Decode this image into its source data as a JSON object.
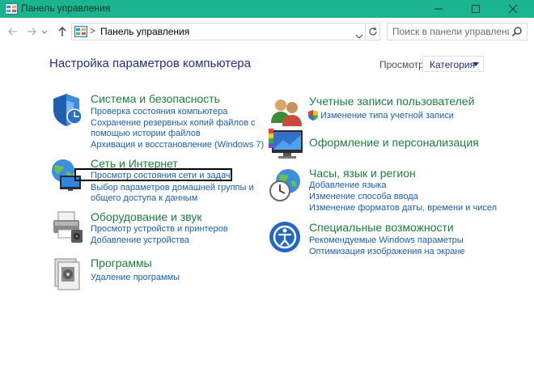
{
  "window": {
    "title": "Панель управления",
    "accent_color": "#1bb48f"
  },
  "navbar": {
    "back_icon": "arrow-left-icon",
    "forward_icon": "arrow-right-icon",
    "up_icon": "arrow-up-icon",
    "breadcrumb_separator": ">",
    "address": "Панель управления",
    "search_placeholder": "Поиск в панели управления"
  },
  "main": {
    "heading": "Настройка параметров компьютера",
    "view_by_label": "Просмотр:",
    "view_by_value": "Категория",
    "link_color": "#1a5fb4",
    "title_color": "#1a7f3a",
    "highlighted_link": "Просмотр состояния сети и задач"
  },
  "categories_left": [
    {
      "icon": "security-shield-icon",
      "title": "Система и безопасность",
      "links": [
        "Проверка состояния компьютера",
        "Сохранение резервных копий файлов с",
        "помощью истории файлов",
        "Архивация и восстановление (Windows 7)"
      ]
    },
    {
      "icon": "network-globe-icon",
      "title": "Сеть и Интернет",
      "links": [
        "Просмотр состояния сети и задач",
        "Выбор параметров домашней группы и",
        "общего доступа к данным"
      ]
    },
    {
      "icon": "printer-icon",
      "title": "Оборудование и звук",
      "links": [
        "Просмотр устройств и принтеров",
        "Добавление устройства"
      ]
    },
    {
      "icon": "programs-icon",
      "title": "Программы",
      "links": [
        "Удаление программы"
      ]
    }
  ],
  "categories_right": [
    {
      "icon": "users-icon",
      "title": "Учетные записи пользователей",
      "links": [
        "Изменение типа учетной записи"
      ]
    },
    {
      "icon": "appearance-monitor-icon",
      "title": "Оформление и персонализация",
      "links": []
    },
    {
      "icon": "clock-globe-icon",
      "title": "Часы, язык и регион",
      "links": [
        "Добавление языка",
        "Изменение способа ввода",
        "Изменение форматов даты, времени и чисел"
      ]
    },
    {
      "icon": "accessibility-icon",
      "title": "Специальные возможности",
      "links": [
        "Рекомендуемые Windows параметры",
        "Оптимизация изображения на экране"
      ]
    }
  ]
}
